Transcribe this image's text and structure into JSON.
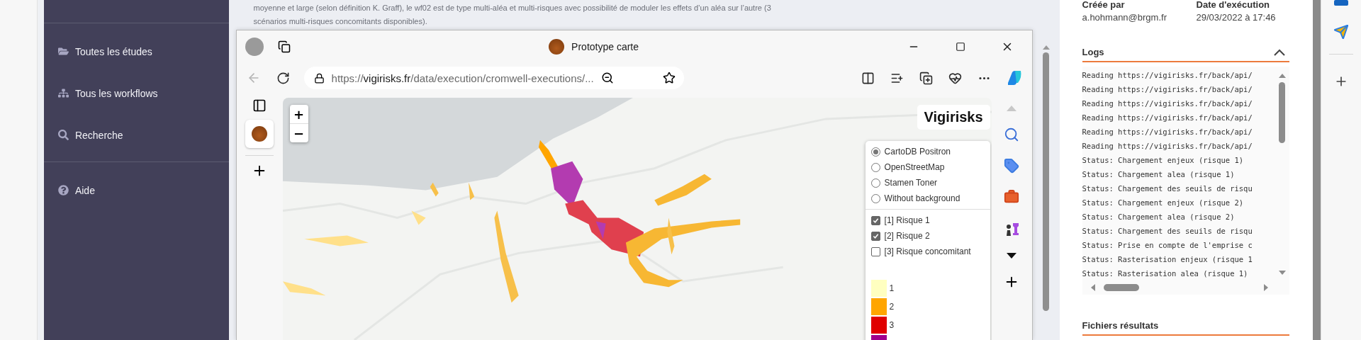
{
  "description": {
    "lines": [
      "moyenne et large (selon définition K. Graff), le wf02 est de type multi-aléa et multi-risques avec possibilité de moduler les effets d’un aléa sur l’autre (3",
      "scénarios multi-risques concomitants disponibles)."
    ]
  },
  "sidebar": {
    "sections": [
      {
        "items": [
          {
            "label": "Toutes les études"
          },
          {
            "label": "Tous les workflows"
          },
          {
            "label": "Recherche"
          }
        ]
      },
      {
        "items": [
          {
            "label": "Aide"
          }
        ]
      }
    ]
  },
  "browser": {
    "title": "Prototype carte",
    "url": "https://**vigirisks.fr**/data/execution/cromwell-executions/...",
    "back_button": {
      "disabled": true
    },
    "vertical_tabs": [
      {
        "selected": true
      }
    ]
  },
  "map": {
    "zoom_in": "+",
    "zoom_out": "−",
    "title": "Vigirisks",
    "base_layers": [
      {
        "label": "CartoDB Positron",
        "selected": true
      },
      {
        "label": "OpenStreetMap",
        "selected": false
      },
      {
        "label": "Stamen Toner",
        "selected": false
      },
      {
        "label": "Without background",
        "selected": false
      }
    ],
    "overlays": [
      {
        "label": "[1] Risque 1",
        "checked": true
      },
      {
        "label": "[2] Risque 2",
        "checked": true
      },
      {
        "label": "[3] Risque concomitant",
        "checked": false
      }
    ],
    "legend": [
      {
        "label": "1",
        "color": "#ffffc0"
      },
      {
        "label": "2",
        "color": "#ffa500"
      },
      {
        "label": "3",
        "color": "#e00000"
      },
      {
        "color": "#a0008c"
      }
    ]
  },
  "details": {
    "created_by_label": "Créée par",
    "created_by": "a.hohmann@brgm.fr",
    "date_label": "Date d'exécution",
    "date": "29/03/2022 à 17:46"
  },
  "logs": {
    "title": "Logs",
    "expanded": true,
    "lines": [
      "Reading https://vigirisks.fr/back/api/",
      "Reading https://vigirisks.fr/back/api/",
      "Reading https://vigirisks.fr/back/api/",
      "Reading https://vigirisks.fr/back/api/",
      "Reading https://vigirisks.fr/back/api/",
      "Reading https://vigirisks.fr/back/api/",
      "Status: Chargement enjeux (risque 1)",
      "Status: Chargement alea (risque 1)",
      "Status: Chargement des seuils de risqu",
      "Status: Chargement enjeux (risque 2)",
      "Status: Chargement alea (risque 2)",
      "Status: Chargement des seuils de risqu",
      "Status: Prise en compte de l'emprise c",
      "Status: Rasterisation enjeux (risque 1",
      "Status: Rasterisation alea (risque 1)"
    ]
  },
  "results": {
    "title": "Fichiers résultats"
  }
}
